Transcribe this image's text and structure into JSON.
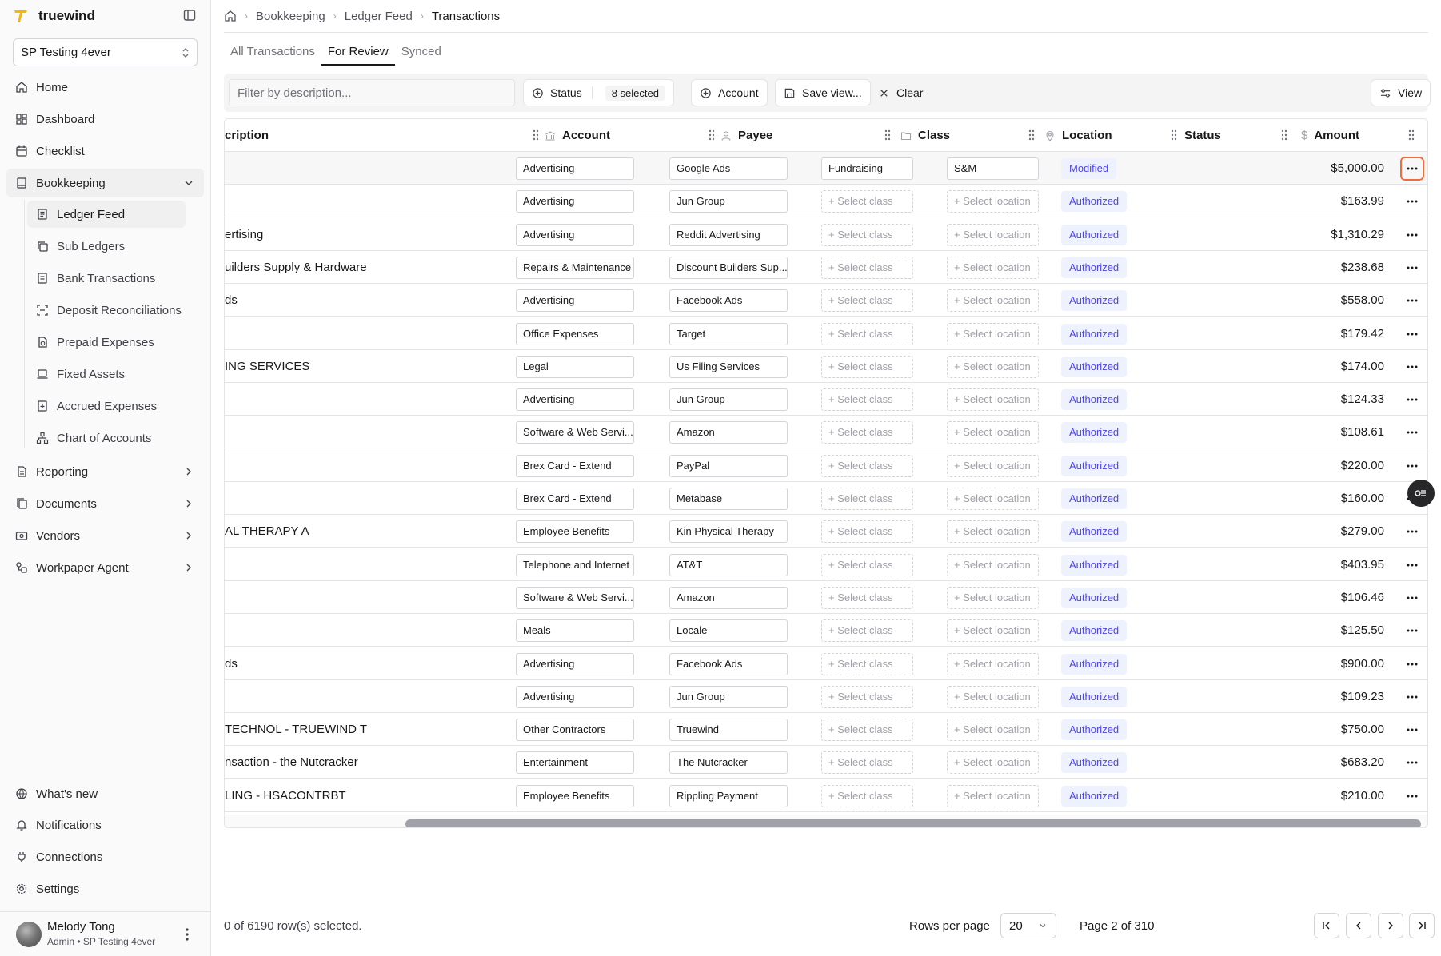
{
  "app": {
    "name": "truewind",
    "organization": "SP Testing 4ever"
  },
  "sidebar": {
    "items": [
      {
        "label": "Home",
        "icon": "home-icon"
      },
      {
        "label": "Dashboard",
        "icon": "dashboard-icon"
      },
      {
        "label": "Checklist",
        "icon": "calendar-icon"
      },
      {
        "label": "Bookkeeping",
        "icon": "book-icon",
        "expanded": true
      }
    ],
    "bookkeeping_items": [
      {
        "label": "Ledger Feed",
        "icon": "ledger-icon",
        "active": true
      },
      {
        "label": "Sub Ledgers",
        "icon": "copy-icon"
      },
      {
        "label": "Bank Transactions",
        "icon": "bank-icon"
      },
      {
        "label": "Deposit Reconciliations",
        "icon": "scan-icon"
      },
      {
        "label": "Prepaid Expenses",
        "icon": "file-clock-icon"
      },
      {
        "label": "Fixed Assets",
        "icon": "laptop-icon"
      },
      {
        "label": "Accrued Expenses",
        "icon": "file-plus-icon"
      },
      {
        "label": "Chart of Accounts",
        "icon": "network-icon"
      }
    ],
    "more_items": [
      {
        "label": "Reporting",
        "icon": "report-icon"
      },
      {
        "label": "Documents",
        "icon": "documents-icon"
      },
      {
        "label": "Vendors",
        "icon": "vendor-icon"
      },
      {
        "label": "Workpaper Agent",
        "icon": "agent-icon"
      }
    ],
    "bottom_items": [
      {
        "label": "What's new",
        "icon": "globe-icon"
      },
      {
        "label": "Notifications",
        "icon": "bell-icon"
      },
      {
        "label": "Connections",
        "icon": "plug-icon"
      },
      {
        "label": "Settings",
        "icon": "gear-icon"
      }
    ],
    "user": {
      "name": "Melody Tong",
      "subtitle": "Admin • SP Testing 4ever"
    }
  },
  "breadcrumb": [
    "Bookkeeping",
    "Ledger Feed",
    "Transactions"
  ],
  "tabs": [
    "All Transactions",
    "For Review",
    "Synced"
  ],
  "toolbar": {
    "filter_placeholder": "Filter by description...",
    "status_label": "Status",
    "status_selected": "8 selected",
    "account_label": "Account",
    "save_view_label": "Save view...",
    "clear_label": "Clear",
    "view_label": "View"
  },
  "table": {
    "headers": {
      "description": "cription",
      "account": "Account",
      "payee": "Payee",
      "class": "Class",
      "location": "Location",
      "status": "Status",
      "amount": "Amount"
    },
    "class_placeholder": "+ Select class",
    "location_placeholder": "+ Select location",
    "rows": [
      {
        "desc": "",
        "account": "Advertising",
        "payee": "Google Ads",
        "class": "Fundraising",
        "location": "S&M",
        "status": "Modified",
        "amount": "$5,000.00"
      },
      {
        "desc": "",
        "account": "Advertising",
        "payee": "Jun Group",
        "class": "",
        "location": "",
        "status": "Authorized",
        "amount": "$163.99"
      },
      {
        "desc": "ertising",
        "account": "Advertising",
        "payee": "Reddit Advertising",
        "class": "",
        "location": "",
        "status": "Authorized",
        "amount": "$1,310.29"
      },
      {
        "desc": "uilders Supply & Hardware",
        "account": "Repairs & Maintenance",
        "payee": "Discount Builders Sup...",
        "class": "",
        "location": "",
        "status": "Authorized",
        "amount": "$238.68"
      },
      {
        "desc": "ds",
        "account": "Advertising",
        "payee": "Facebook Ads",
        "class": "",
        "location": "",
        "status": "Authorized",
        "amount": "$558.00"
      },
      {
        "desc": "",
        "account": "Office Expenses",
        "payee": "Target",
        "class": "",
        "location": "",
        "status": "Authorized",
        "amount": "$179.42"
      },
      {
        "desc": "ING SERVICES",
        "account": "Legal",
        "payee": "Us Filing Services",
        "class": "",
        "location": "",
        "status": "Authorized",
        "amount": "$174.00"
      },
      {
        "desc": "",
        "account": "Advertising",
        "payee": "Jun Group",
        "class": "",
        "location": "",
        "status": "Authorized",
        "amount": "$124.33"
      },
      {
        "desc": "",
        "account": "Software & Web Servi...",
        "payee": "Amazon",
        "class": "",
        "location": "",
        "status": "Authorized",
        "amount": "$108.61"
      },
      {
        "desc": "",
        "account": "Brex Card - Extend",
        "payee": "PayPal",
        "class": "",
        "location": "",
        "status": "Authorized",
        "amount": "$220.00"
      },
      {
        "desc": "",
        "account": "Brex Card - Extend",
        "payee": "Metabase",
        "class": "",
        "location": "",
        "status": "Authorized",
        "amount": "$160.00"
      },
      {
        "desc": "AL THERAPY A",
        "account": "Employee Benefits",
        "payee": "Kin Physical Therapy",
        "class": "",
        "location": "",
        "status": "Authorized",
        "amount": "$279.00"
      },
      {
        "desc": "",
        "account": "Telephone and Internet",
        "payee": "AT&T",
        "class": "",
        "location": "",
        "status": "Authorized",
        "amount": "$403.95"
      },
      {
        "desc": "",
        "account": "Software & Web Servi...",
        "payee": "Amazon",
        "class": "",
        "location": "",
        "status": "Authorized",
        "amount": "$106.46"
      },
      {
        "desc": "",
        "account": "Meals",
        "payee": "Locale",
        "class": "",
        "location": "",
        "status": "Authorized",
        "amount": "$125.50"
      },
      {
        "desc": "ds",
        "account": "Advertising",
        "payee": "Facebook Ads",
        "class": "",
        "location": "",
        "status": "Authorized",
        "amount": "$900.00"
      },
      {
        "desc": "",
        "account": "Advertising",
        "payee": "Jun Group",
        "class": "",
        "location": "",
        "status": "Authorized",
        "amount": "$109.23"
      },
      {
        "desc": "TECHNOL - TRUEWIND T",
        "account": "Other Contractors",
        "payee": "Truewind",
        "class": "",
        "location": "",
        "status": "Authorized",
        "amount": "$750.00"
      },
      {
        "desc": "nsaction - the Nutcracker",
        "account": "Entertainment",
        "payee": "The Nutcracker",
        "class": "",
        "location": "",
        "status": "Authorized",
        "amount": "$683.20"
      },
      {
        "desc": "LING - HSACONTRBT",
        "account": "Employee Benefits",
        "payee": "Rippling Payment",
        "class": "",
        "location": "",
        "status": "Authorized",
        "amount": "$210.00"
      }
    ]
  },
  "footer": {
    "selected_text": "0 of 6190 row(s) selected.",
    "rows_per_page_label": "Rows per page",
    "rows_per_page_value": "20",
    "page_text": "Page 2 of 310"
  },
  "colors": {
    "brand": "#f5b700",
    "status_badge_bg": "#eef2ff",
    "status_badge_text": "#4f46e5",
    "focus_ring": "#f26b3a"
  }
}
